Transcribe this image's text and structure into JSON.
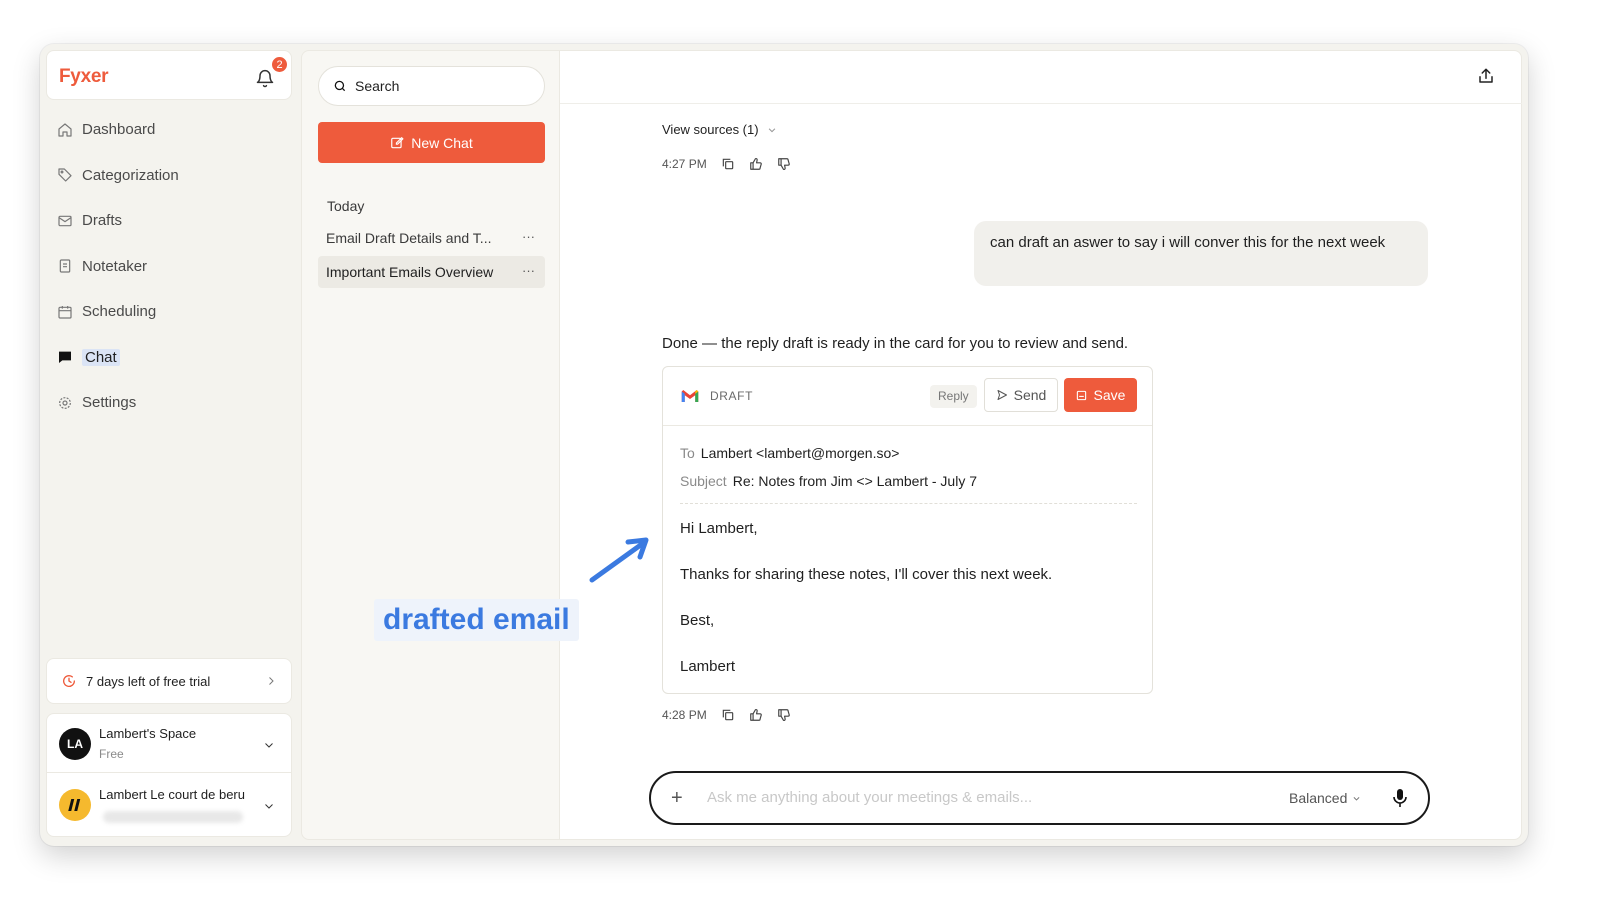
{
  "app": {
    "logo": "Fyxer",
    "notification_count": "2",
    "accent_color": "#ee5b3c"
  },
  "sidebar": {
    "items": [
      {
        "label": "Dashboard",
        "icon": "home-icon"
      },
      {
        "label": "Categorization",
        "icon": "tag-icon"
      },
      {
        "label": "Drafts",
        "icon": "mail-icon"
      },
      {
        "label": "Notetaker",
        "icon": "notes-icon"
      },
      {
        "label": "Scheduling",
        "icon": "calendar-icon"
      },
      {
        "label": "Chat",
        "icon": "chat-icon",
        "active": true
      },
      {
        "label": "Settings",
        "icon": "gear-icon"
      }
    ],
    "trial": "7 days left of free trial",
    "space": {
      "initials": "LA",
      "name": "Lambert's Space",
      "plan": "Free"
    },
    "account": {
      "name": "Lambert Le court de beru"
    }
  },
  "conversations": {
    "search_placeholder": "Search",
    "new_chat_label": "New Chat",
    "group_label": "Today",
    "items": [
      {
        "title": "Email Draft Details and T...",
        "menu": "···"
      },
      {
        "title": "Important Emails Overview",
        "menu": "···",
        "active": true
      }
    ]
  },
  "chat": {
    "view_sources": "View sources (1)",
    "time1": "4:27 PM",
    "user_message": "can draft an aswer to say i will conver this for the next week",
    "assistant_message": "Done — the reply draft is ready in the card for you to review and send.",
    "time2": "4:28 PM",
    "draft": {
      "label": "DRAFT",
      "reply_label": "Reply",
      "send_label": "Send",
      "save_label": "Save",
      "to_key": "To",
      "to_value": "Lambert <lambert@morgen.so>",
      "subject_key": "Subject",
      "subject_value": "Re: Notes from Jim <> Lambert - July 7",
      "body": [
        "Hi Lambert,",
        "Thanks for sharing these notes, I'll cover this next week.",
        "Best,",
        "Lambert"
      ]
    },
    "composer": {
      "plus": "+",
      "placeholder": "Ask me anything about your meetings & emails...",
      "mode": "Balanced"
    }
  },
  "annotation": {
    "label": "drafted email",
    "color": "#3b7ae0"
  }
}
